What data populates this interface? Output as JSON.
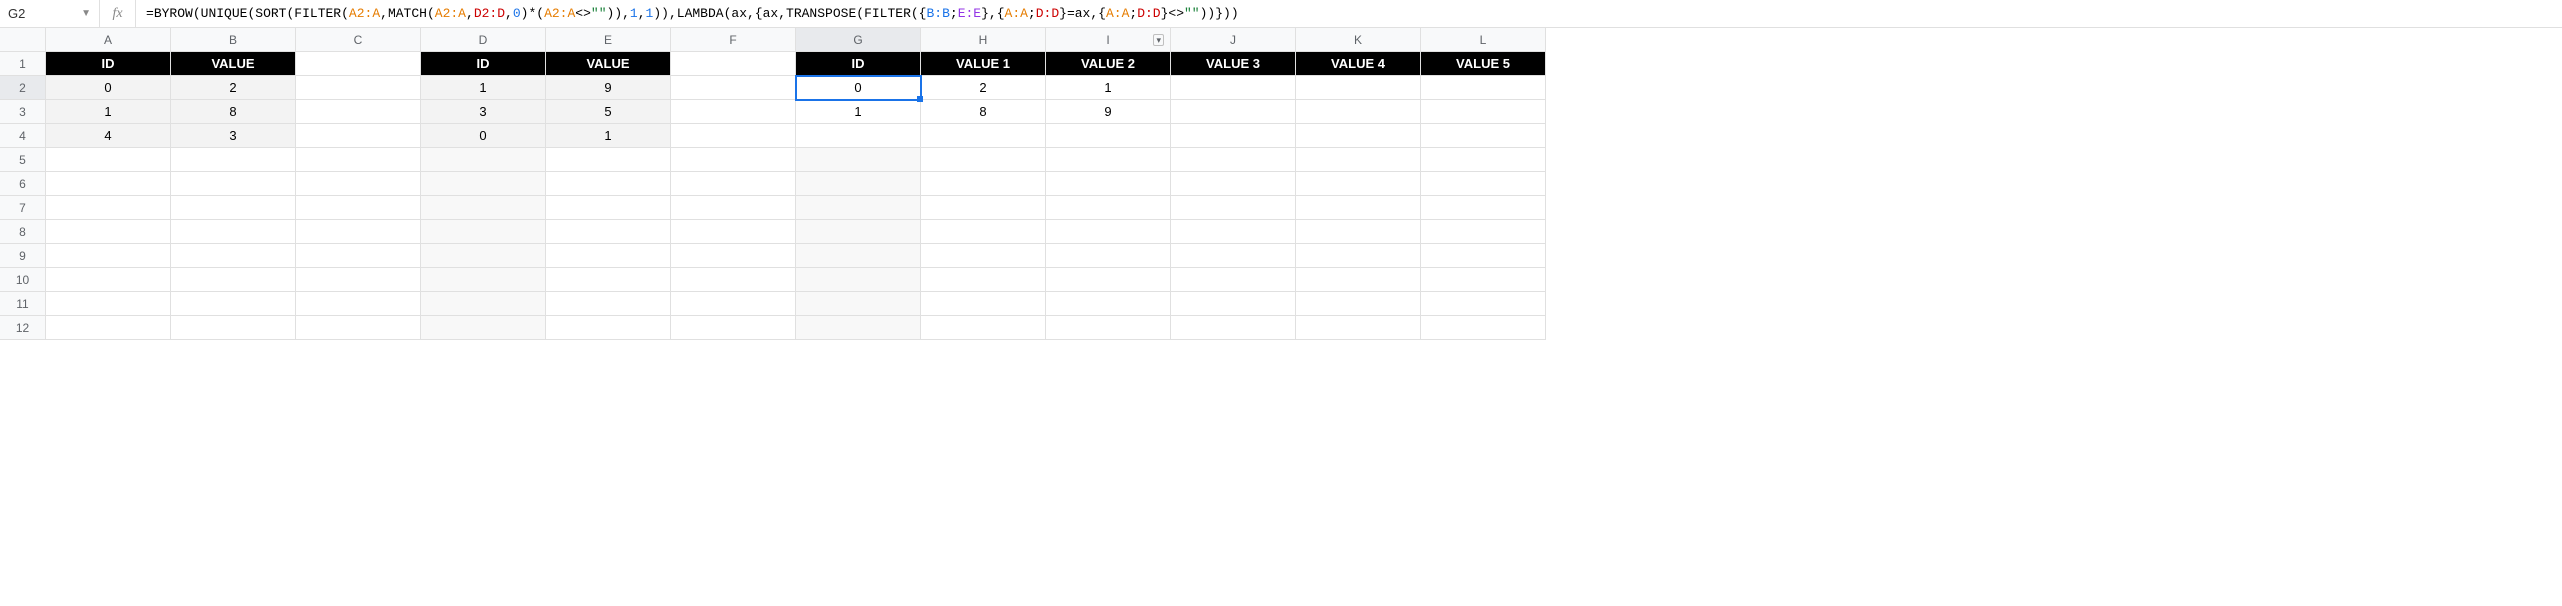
{
  "nameBox": {
    "value": "G2"
  },
  "fxLabel": "fx",
  "formula": {
    "tokens": [
      {
        "t": "=",
        "c": "fn"
      },
      {
        "t": "BYROW",
        "c": "fn"
      },
      {
        "t": "(",
        "c": "fn"
      },
      {
        "t": "UNIQUE",
        "c": "fn"
      },
      {
        "t": "(",
        "c": "fn"
      },
      {
        "t": "SORT",
        "c": "fn"
      },
      {
        "t": "(",
        "c": "fn"
      },
      {
        "t": "FILTER",
        "c": "fn"
      },
      {
        "t": "(",
        "c": "fn"
      },
      {
        "t": "A2:A",
        "c": "ref-orange"
      },
      {
        "t": ",",
        "c": "fn"
      },
      {
        "t": "MATCH",
        "c": "fn"
      },
      {
        "t": "(",
        "c": "fn"
      },
      {
        "t": "A2:A",
        "c": "ref-orange"
      },
      {
        "t": ",",
        "c": "fn"
      },
      {
        "t": "D2:D",
        "c": "ref-red"
      },
      {
        "t": ",",
        "c": "fn"
      },
      {
        "t": "0",
        "c": "num"
      },
      {
        "t": ")*",
        "c": "fn"
      },
      {
        "t": "(",
        "c": "fn"
      },
      {
        "t": "A2:A",
        "c": "ref-orange"
      },
      {
        "t": "<>",
        "c": "fn"
      },
      {
        "t": "\"\"",
        "c": "str"
      },
      {
        "t": ")),",
        "c": "fn"
      },
      {
        "t": "1",
        "c": "num"
      },
      {
        "t": ",",
        "c": "fn"
      },
      {
        "t": "1",
        "c": "num"
      },
      {
        "t": ")),",
        "c": "fn"
      },
      {
        "t": "LAMBDA",
        "c": "fn"
      },
      {
        "t": "(",
        "c": "fn"
      },
      {
        "t": "ax",
        "c": "fn"
      },
      {
        "t": ",{",
        "c": "fn"
      },
      {
        "t": "ax",
        "c": "fn"
      },
      {
        "t": ",",
        "c": "fn"
      },
      {
        "t": "TRANSPOSE",
        "c": "fn"
      },
      {
        "t": "(",
        "c": "fn"
      },
      {
        "t": "FILTER",
        "c": "fn"
      },
      {
        "t": "({",
        "c": "fn"
      },
      {
        "t": "B:B",
        "c": "ref-blue"
      },
      {
        "t": ";",
        "c": "fn"
      },
      {
        "t": "E:E",
        "c": "ref-purple"
      },
      {
        "t": "},{",
        "c": "fn"
      },
      {
        "t": "A:A",
        "c": "ref-orange"
      },
      {
        "t": ";",
        "c": "fn"
      },
      {
        "t": "D:D",
        "c": "ref-red"
      },
      {
        "t": "}=",
        "c": "fn"
      },
      {
        "t": "ax",
        "c": "fn"
      },
      {
        "t": ",{",
        "c": "fn"
      },
      {
        "t": "A:A",
        "c": "ref-orange"
      },
      {
        "t": ";",
        "c": "fn"
      },
      {
        "t": "D:D",
        "c": "ref-red"
      },
      {
        "t": "}<>",
        "c": "fn"
      },
      {
        "t": "\"\"",
        "c": "str"
      },
      {
        "t": "))}))",
        "c": "fn"
      }
    ]
  },
  "columns": [
    "A",
    "B",
    "C",
    "D",
    "E",
    "F",
    "G",
    "H",
    "I",
    "J",
    "K",
    "L"
  ],
  "rows": [
    "1",
    "2",
    "3",
    "4",
    "5",
    "6",
    "7",
    "8",
    "9",
    "10",
    "11",
    "12"
  ],
  "activeCell": "G2",
  "filterColumn": "I",
  "headerRow": {
    "A": "ID",
    "B": "VALUE",
    "D": "ID",
    "E": "VALUE",
    "G": "ID",
    "H": "VALUE 1",
    "I": "VALUE 2",
    "J": "VALUE 3",
    "K": "VALUE 4",
    "L": "VALUE 5"
  },
  "dataCells": {
    "A2": "0",
    "B2": "2",
    "D2": "1",
    "E2": "9",
    "G2": "0",
    "H2": "2",
    "I2": "1",
    "A3": "1",
    "B3": "8",
    "D3": "3",
    "E3": "5",
    "G3": "1",
    "H3": "8",
    "I3": "9",
    "A4": "4",
    "B4": "3",
    "D4": "0",
    "E4": "1"
  },
  "shadedCells": [
    "A2",
    "B2",
    "A3",
    "B3",
    "A4",
    "B4",
    "D2",
    "E2",
    "D3",
    "E3",
    "D4",
    "E4"
  ],
  "shadedColumns": [
    "D",
    "G"
  ],
  "shadedColumnRows": [
    "5",
    "6",
    "7",
    "8",
    "9",
    "10",
    "11",
    "12"
  ]
}
